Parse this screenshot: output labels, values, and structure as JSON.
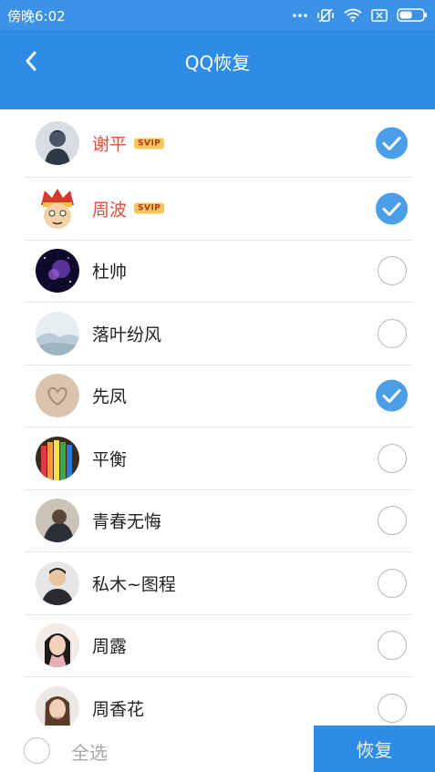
{
  "status": {
    "time": "傍晚6:02"
  },
  "header": {
    "title": "QQ恢复"
  },
  "contacts": [
    {
      "name": "谢平",
      "svip": "SVIP",
      "checked": true
    },
    {
      "name": "周波",
      "svip": "SVIP",
      "checked": true
    },
    {
      "name": "杜帅",
      "checked": false
    },
    {
      "name": "落叶纷风",
      "checked": false
    },
    {
      "name": "先凤",
      "checked": true
    },
    {
      "name": "平衡",
      "checked": false
    },
    {
      "name": "青春无悔",
      "checked": false
    },
    {
      "name": "私木~图程",
      "checked": false
    },
    {
      "name": "周露",
      "checked": false
    },
    {
      "name": "周香花",
      "checked": false
    }
  ],
  "footer": {
    "select_all": "全选",
    "restore": "恢复"
  }
}
